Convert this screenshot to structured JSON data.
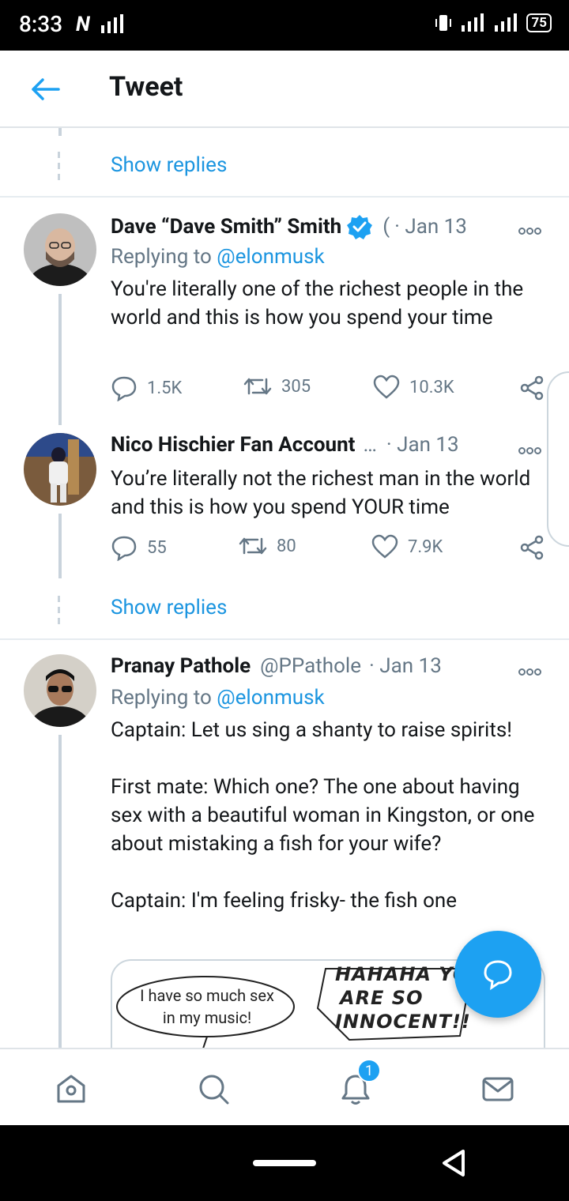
{
  "status_bar": {
    "time": "8:33",
    "network_icon": "N",
    "battery": "75"
  },
  "header": {
    "title": "Tweet"
  },
  "show_replies_1": "Show replies",
  "tweets": [
    {
      "name": "Dave “Dave Smith” Smith",
      "handle": "(",
      "date": "· Jan 13",
      "verified": true,
      "replying_label": "Replying to",
      "replying_handle": "@elonmusk",
      "text": "You're literally one of the richest people in the world and this is how you spend your time",
      "replies": "1.5K",
      "retweets": "305",
      "likes": "10.3K"
    },
    {
      "name": "Nico Hischier Fan Account",
      "handle": "…",
      "date": "· Jan 13",
      "text": "You’re literally not the richest man in the world and this is how you spend YOUR time",
      "replies": "55",
      "retweets": "80",
      "likes": "7.9K"
    },
    {
      "name": "Pranay Pathole",
      "handle": "@PPathole",
      "date": "· Jan 13",
      "replying_label": "Replying to",
      "replying_handle": "@elonmusk",
      "text": "Captain: Let us sing a shanty to raise spirits!\n\nFirst mate: Which one? The one about having sex with a beautiful woman in Kingston, or one about mistaking a fish for your wife?\n\nCaptain: I'm feeling frisky- the fish one"
    }
  ],
  "show_replies_2": "Show replies",
  "media": {
    "bubble_left": "I have so much sex in my music!",
    "bubble_right_1": "HAHAHA YO",
    "bubble_right_2": "ARE SO",
    "bubble_right_3": "INNOCENT!!"
  },
  "bottom_nav": {
    "notifications_badge": "1"
  },
  "colors": {
    "accent": "#1da1f2",
    "link": "#1b95e0",
    "muted": "#657786"
  }
}
